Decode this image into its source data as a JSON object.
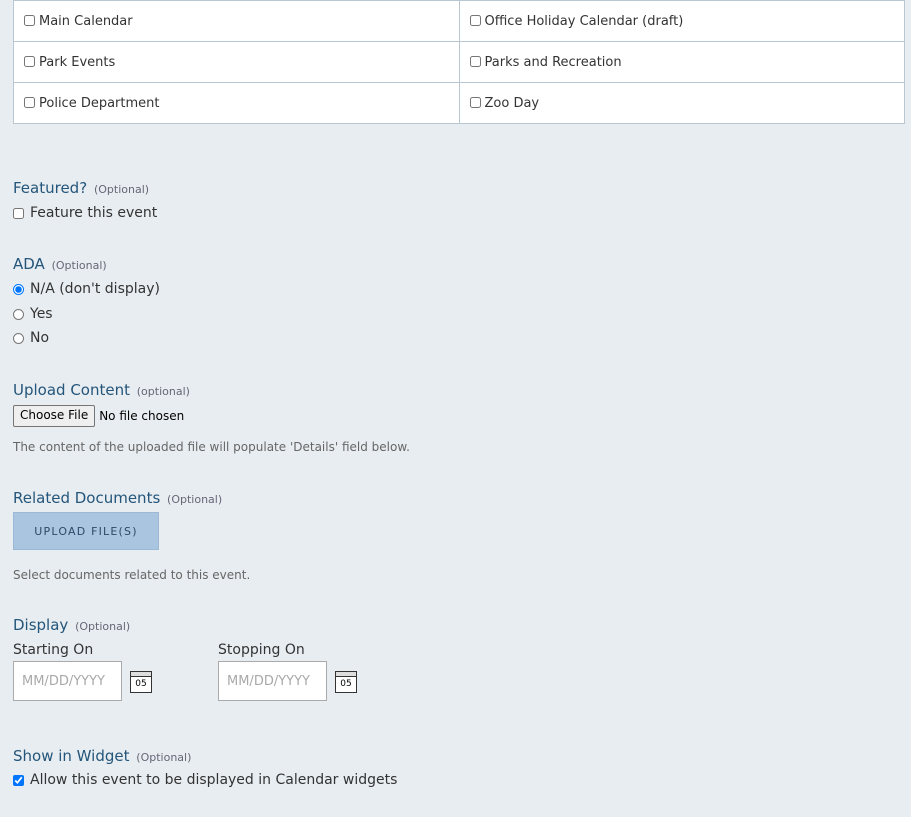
{
  "calendars": [
    {
      "label": "Main Calendar",
      "checked": false
    },
    {
      "label": "Office Holiday Calendar (draft)",
      "checked": false
    },
    {
      "label": "Park Events",
      "checked": false
    },
    {
      "label": "Parks and Recreation",
      "checked": false
    },
    {
      "label": "Police Department",
      "checked": false
    },
    {
      "label": "Zoo Day",
      "checked": false
    }
  ],
  "featured": {
    "title": "Featured?",
    "optional": "(Optional)",
    "checkbox_label": "Feature this event",
    "checked": false
  },
  "ada": {
    "title": "ADA",
    "optional": "(Optional)",
    "options": [
      {
        "label": "N/A (don't display)",
        "selected": true
      },
      {
        "label": "Yes",
        "selected": false
      },
      {
        "label": "No",
        "selected": false
      }
    ]
  },
  "upload_content": {
    "title": "Upload Content",
    "optional": "(optional)",
    "button_label": "Choose File",
    "status": "No file chosen",
    "help": "The content of the uploaded file will populate 'Details' field below."
  },
  "related_documents": {
    "title": "Related Documents",
    "optional": "(Optional)",
    "button_label": "UPLOAD FILE(S)",
    "help": "Select documents related to this event."
  },
  "display": {
    "title": "Display",
    "optional": "(Optional)",
    "starting_label": "Starting On",
    "stopping_label": "Stopping On",
    "date_placeholder": "MM/DD/YYYY",
    "calendar_icon_day": "05"
  },
  "widget": {
    "title": "Show in Widget",
    "optional": "(Optional)",
    "checkbox_label": "Allow this event to be displayed in Calendar widgets",
    "checked": true
  }
}
